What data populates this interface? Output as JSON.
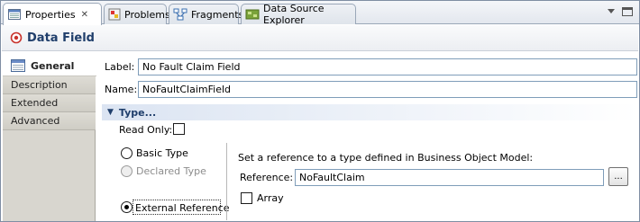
{
  "tabs": [
    {
      "label": "Properties",
      "icon": "properties-icon",
      "active": true,
      "closable": true
    },
    {
      "label": "Problems",
      "icon": "problems-icon",
      "active": false
    },
    {
      "label": "Fragments",
      "icon": "fragments-icon",
      "active": false
    },
    {
      "label": "Data Source Explorer",
      "icon": "data-source-explorer-icon",
      "active": false
    }
  ],
  "title": {
    "text": "Data Field",
    "icon": "data-field-icon"
  },
  "nav": [
    {
      "label": "General",
      "icon": "general-icon",
      "active": true
    },
    {
      "label": "Description",
      "active": false
    },
    {
      "label": "Extended",
      "active": false
    },
    {
      "label": "Advanced",
      "active": false
    }
  ],
  "form": {
    "label_caption": "Label:",
    "label_value": "No Fault Claim Field",
    "name_caption": "Name:",
    "name_value": "NoFaultClaimField"
  },
  "type_section": {
    "title": "Type...",
    "read_only_label": "Read Only:",
    "read_only_checked": false,
    "options": [
      {
        "label": "Basic Type",
        "checked": false,
        "enabled": true
      },
      {
        "label": "Declared Type",
        "checked": false,
        "enabled": false
      },
      {
        "label": "External Reference",
        "checked": true,
        "enabled": true
      }
    ],
    "hint": "Set a reference to a type defined in Business Object Model:",
    "reference_label": "Reference:",
    "reference_value": "NoFaultClaim",
    "browse_label": "...",
    "array_label": "Array",
    "array_checked": false
  },
  "colors": {
    "accent": "#1f3e6b",
    "nav_bg": "#d8d6cf",
    "border": "#7f9db9"
  }
}
